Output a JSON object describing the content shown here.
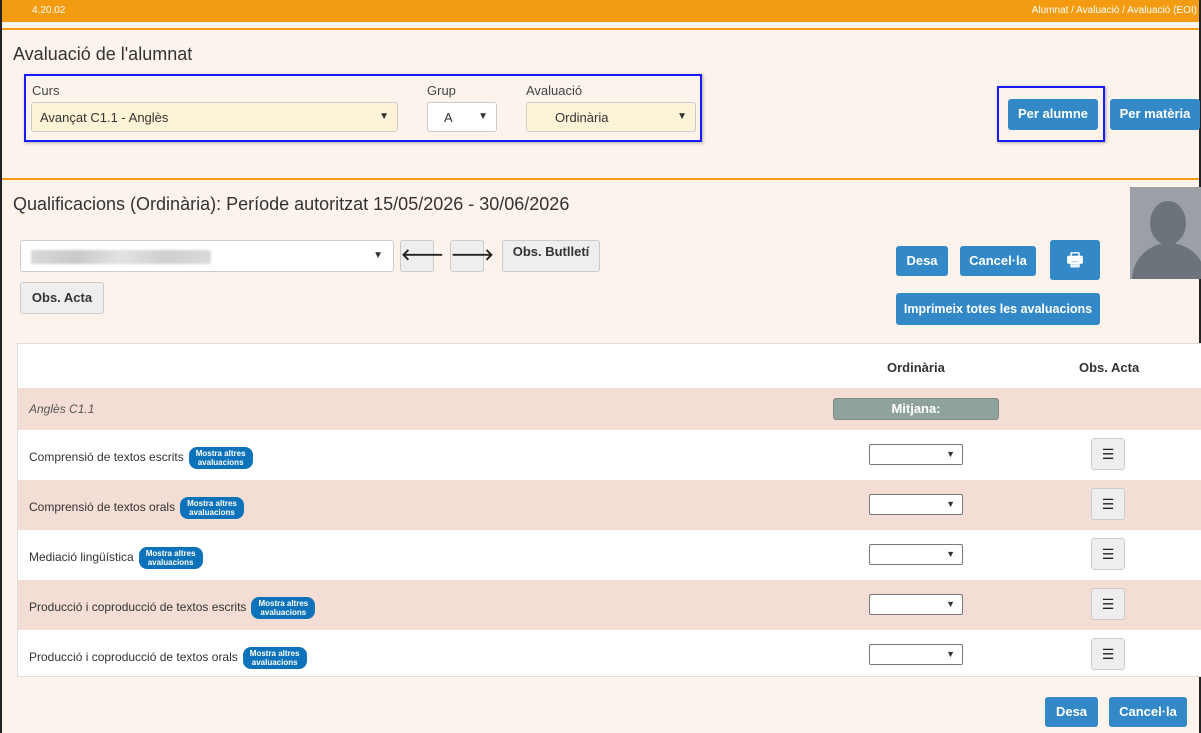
{
  "topbar": {
    "version": "4.20.02",
    "breadcrumb": "Alumnat / Avaluació / Avaluació (EOI)"
  },
  "filters": {
    "title": "Avaluació de l'alumnat",
    "curs_label": "Curs",
    "curs_value": "Avançat C1.1 - Anglès",
    "grup_label": "Grup",
    "grup_value": "A",
    "avaluacio_label": "Avaluació",
    "avaluacio_value": "Ordinària",
    "per_alumne": "Per alumne",
    "per_materia": "Per matèria"
  },
  "grades": {
    "title": "Qualificacions (Ordinària): Període autoritzat 15/05/2026 - 30/06/2026",
    "obs_butlleti": "Obs. Butlletí",
    "obs_acta": "Obs. Acta",
    "desa": "Desa",
    "cancel": "Cancel·la",
    "print_all": "Imprimeix totes les avaluacions",
    "col_ordinaria": "Ordinària",
    "col_obs_acta": "Obs. Acta",
    "subject": "Anglès C1.1",
    "mitjana": "Mitjana:",
    "badge_line1": "Mostra altres",
    "badge_line2": "avaluacions",
    "rows": [
      {
        "label": "Comprensió de textos escrits"
      },
      {
        "label": "Comprensió de textos orals"
      },
      {
        "label": "Mediació lingüística"
      },
      {
        "label": "Producció i coproducció de textos escrits"
      },
      {
        "label": "Producció i coproducció de textos orals"
      }
    ]
  },
  "colors": {
    "accent": "#f39c12",
    "primary": "#3389c7",
    "badge": "#0c72b9",
    "row_alt": "#f3ddd5",
    "highlight": "#1a1aff"
  }
}
